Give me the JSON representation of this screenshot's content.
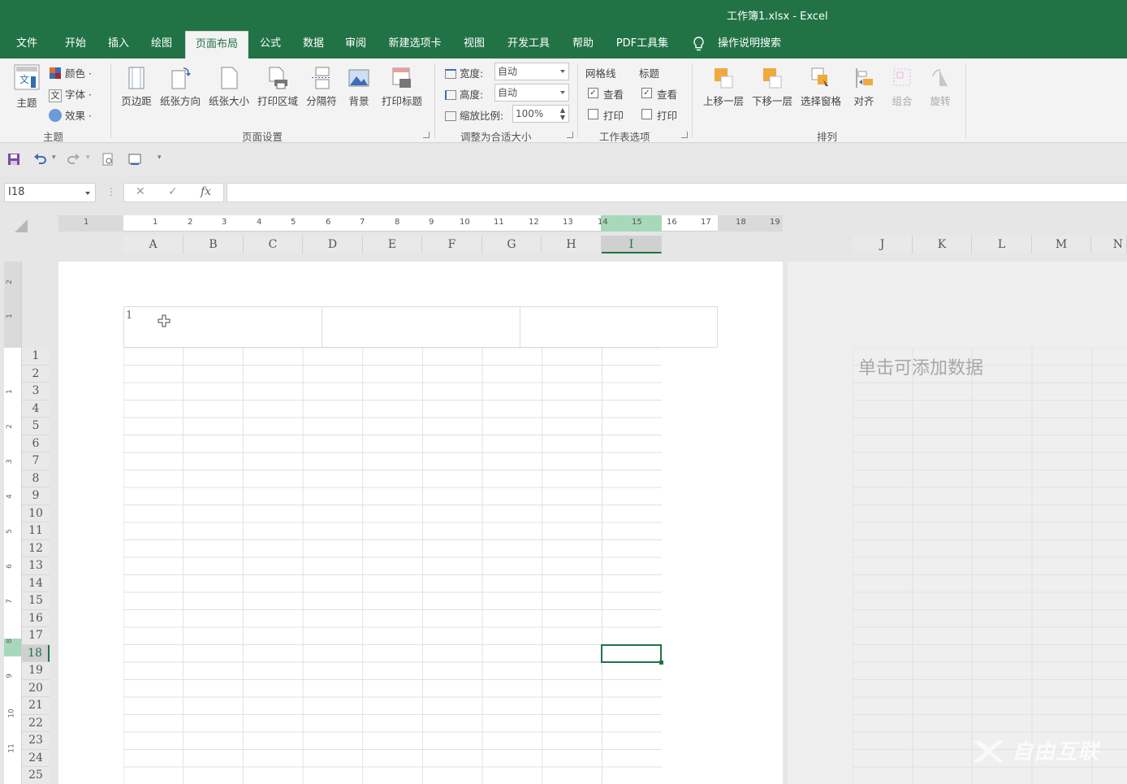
{
  "window": {
    "title": "工作簿1.xlsx  -  Excel"
  },
  "tabs": [
    {
      "label": "文件"
    },
    {
      "label": "开始"
    },
    {
      "label": "插入"
    },
    {
      "label": "绘图"
    },
    {
      "label": "页面布局"
    },
    {
      "label": "公式"
    },
    {
      "label": "数据"
    },
    {
      "label": "审阅"
    },
    {
      "label": "新建选项卡"
    },
    {
      "label": "视图"
    },
    {
      "label": "开发工具"
    },
    {
      "label": "帮助"
    },
    {
      "label": "PDF工具集"
    },
    {
      "label": "操作说明搜索"
    }
  ],
  "ribbon": {
    "theme": {
      "main": "主题",
      "colors": "颜色",
      "fonts": "字体",
      "effects": "效果",
      "group": "主题"
    },
    "page_setup": {
      "margins": "页边距",
      "orientation": "纸张方向",
      "size": "纸张大小",
      "print_area": "打印区域",
      "breaks": "分隔符",
      "background": "背景",
      "print_titles": "打印标题",
      "group": "页面设置"
    },
    "scale": {
      "width_label": "宽度:",
      "width_value": "自动",
      "height_label": "高度:",
      "height_value": "自动",
      "scale_label": "缩放比例:",
      "scale_value": "100%",
      "group": "调整为合适大小"
    },
    "sheet_options": {
      "gridlines": "网格线",
      "headings": "标题",
      "view": "查看",
      "print": "打印",
      "group": "工作表选项"
    },
    "arrange": {
      "bring_forward": "上移一层",
      "send_backward": "下移一层",
      "selection_pane": "选择窗格",
      "align": "对齐",
      "group_btn": "组合",
      "rotate": "旋转",
      "group": "排列"
    }
  },
  "formula_bar": {
    "name_box": "I18",
    "fx": "fx"
  },
  "ruler": {
    "ticks": [
      "1",
      "1",
      "2",
      "3",
      "4",
      "5",
      "6",
      "7",
      "8",
      "9",
      "10",
      "11",
      "12",
      "13",
      "14",
      "15",
      "16",
      "17",
      "18",
      "19"
    ]
  },
  "columns": [
    "A",
    "B",
    "C",
    "D",
    "E",
    "F",
    "G",
    "H",
    "I"
  ],
  "columns_page2": [
    "J",
    "K",
    "L",
    "M",
    "N"
  ],
  "rows": [
    "1",
    "2",
    "3",
    "4",
    "5",
    "6",
    "7",
    "8",
    "9",
    "10",
    "11",
    "12",
    "13",
    "14",
    "15",
    "16",
    "17",
    "18",
    "19",
    "20",
    "21",
    "22",
    "23",
    "24",
    "25"
  ],
  "vruler": [
    "2",
    "1",
    "1",
    "2",
    "3",
    "4",
    "5",
    "6",
    "7",
    "8",
    "9",
    "10",
    "11"
  ],
  "sheet": {
    "header_text": "1",
    "page2_hint": "单击可添加数据",
    "selected_cell": "I18"
  },
  "watermark": "自由互联",
  "colors": {
    "accent": "#217346",
    "ribbon_bg": "#f3f3f3"
  }
}
